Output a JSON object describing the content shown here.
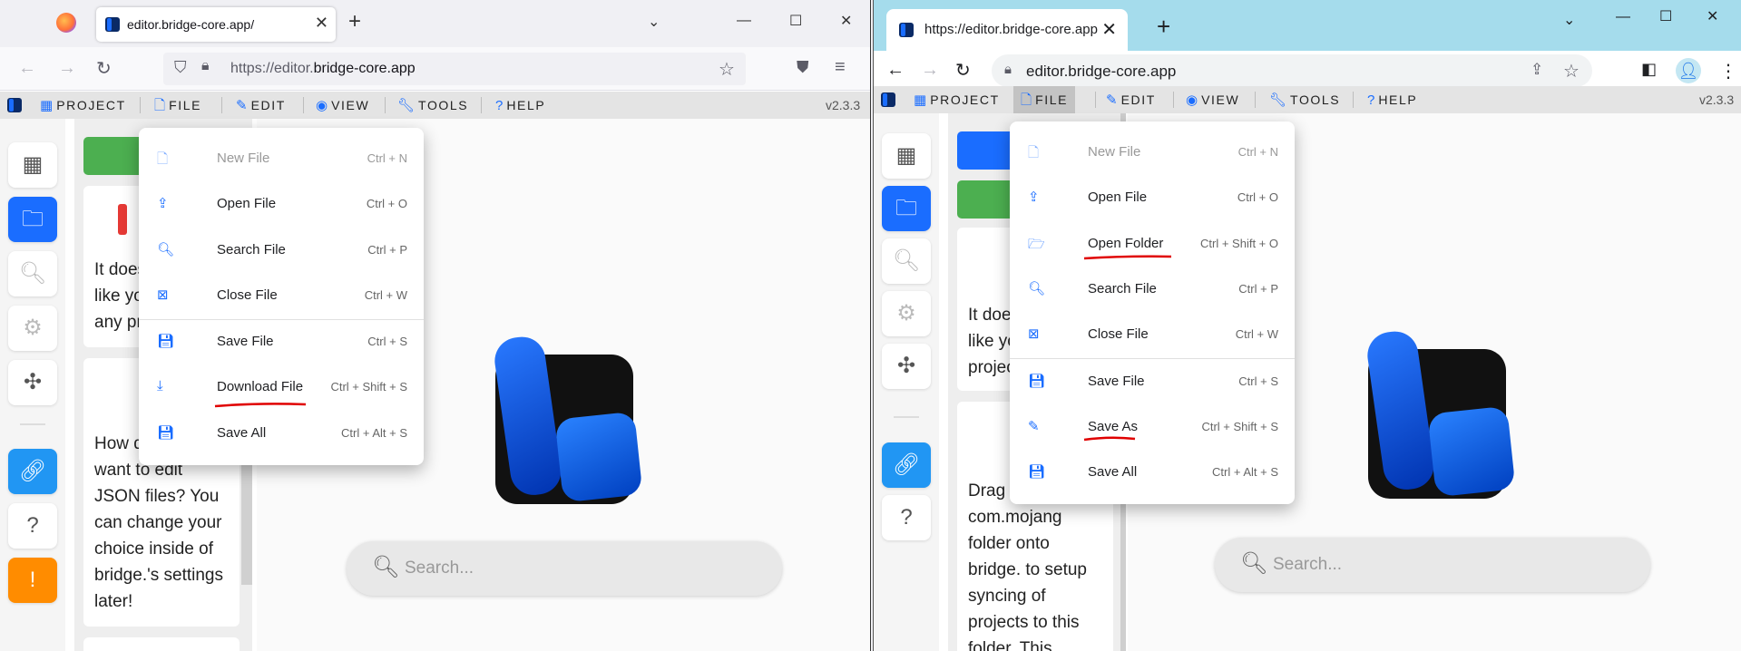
{
  "left": {
    "browser": {
      "tab_title": "editor.bridge-core.app/",
      "url_prefix": "https://editor.",
      "url_host": "bridge-core.app"
    },
    "menubar": {
      "items": [
        {
          "label": "PROJECT",
          "icon": "grid-icon"
        },
        {
          "label": "FILE",
          "icon": "file-icon"
        },
        {
          "label": "EDIT",
          "icon": "pencil-icon"
        },
        {
          "label": "VIEW",
          "icon": "eye-icon"
        },
        {
          "label": "TOOLS",
          "icon": "wrench-icon"
        },
        {
          "label": "HELP",
          "icon": "question-icon"
        }
      ],
      "version": "v2.3.3"
    },
    "file_menu": [
      {
        "label": "New File",
        "shortcut": "Ctrl + N",
        "icon": "new-file-icon",
        "disabled": true
      },
      {
        "label": "Open File",
        "shortcut": "Ctrl + O",
        "icon": "open-file-icon"
      },
      {
        "label": "Search File",
        "shortcut": "Ctrl + P",
        "icon": "search-icon"
      },
      {
        "label": "Close File",
        "shortcut": "Ctrl + W",
        "icon": "close-file-icon"
      },
      {
        "label": "Save File",
        "shortcut": "Ctrl + S",
        "icon": "save-icon"
      },
      {
        "label": "Download File",
        "shortcut": "Ctrl + Shift + S",
        "icon": "download-icon",
        "underlined": true
      },
      {
        "label": "Save All",
        "shortcut": "Ctrl + Alt + S",
        "icon": "save-all-icon"
      }
    ],
    "panel": {
      "card1_lines": [
        "It does",
        "like yo",
        "any pr"
      ],
      "card2_lines": [
        "How d",
        "want to edit",
        "JSON files? You",
        "can change your",
        "choice inside of",
        "bridge.'s settings",
        "later!"
      ]
    },
    "search_placeholder": "Search..."
  },
  "right": {
    "browser": {
      "tab_title": "https://editor.bridge-core.app",
      "url": "editor.bridge-core.app"
    },
    "menubar": {
      "items": [
        {
          "label": "PROJECT",
          "icon": "grid-icon"
        },
        {
          "label": "FILE",
          "icon": "file-icon"
        },
        {
          "label": "EDIT",
          "icon": "pencil-icon"
        },
        {
          "label": "VIEW",
          "icon": "eye-icon"
        },
        {
          "label": "TOOLS",
          "icon": "wrench-icon"
        },
        {
          "label": "HELP",
          "icon": "question-icon"
        }
      ],
      "version": "v2.3.3"
    },
    "file_menu": [
      {
        "label": "New File",
        "shortcut": "Ctrl + N",
        "icon": "new-file-icon",
        "disabled": true
      },
      {
        "label": "Open File",
        "shortcut": "Ctrl + O",
        "icon": "open-file-icon"
      },
      {
        "label": "Open Folder",
        "shortcut": "Ctrl + Shift + O",
        "icon": "folder-icon",
        "underlined": true
      },
      {
        "label": "Search File",
        "shortcut": "Ctrl + P",
        "icon": "search-icon"
      },
      {
        "label": "Close File",
        "shortcut": "Ctrl + W",
        "icon": "close-file-icon"
      },
      {
        "label": "Save File",
        "shortcut": "Ctrl + S",
        "icon": "save-icon"
      },
      {
        "label": "Save As",
        "shortcut": "Ctrl + Shift + S",
        "icon": "save-as-icon",
        "underlined": true
      },
      {
        "label": "Save All",
        "shortcut": "Ctrl + Alt + S",
        "icon": "save-all-icon"
      }
    ],
    "panel": {
      "card1_lines": [
        "It does",
        "like yo",
        "projec"
      ],
      "card2_lines": [
        "Drag y",
        "com.mojang",
        "folder onto",
        "bridge. to setup",
        "syncing of",
        "projects to this",
        "folder. This"
      ]
    },
    "search_placeholder": "Search..."
  },
  "colors": {
    "accent": "#1a6dff",
    "green": "#4caf50",
    "warning": "#ff8c00",
    "link": "#2196f3",
    "annotation": "#e00000"
  }
}
